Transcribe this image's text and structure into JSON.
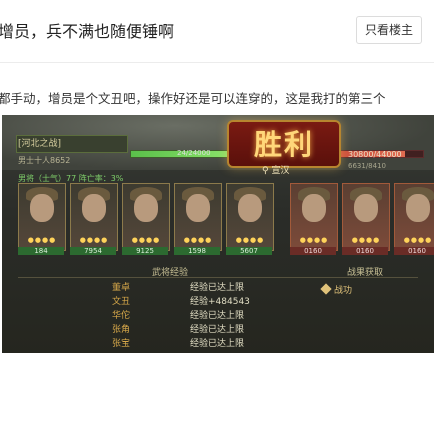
{
  "header": {
    "title": "增员，兵不满也随便锤啊",
    "only_op_label": "只看楼主"
  },
  "post": {
    "text": "都手动，增员是个文丑吧，操作好还是可以连穿的，这是我打的第三个"
  },
  "game": {
    "top_label": "[河北之战]",
    "sub_label": "男士十人8652",
    "army_info": "男将（士气）77  阵亡率：3%",
    "green_value": "24/24000",
    "score": "30800/44000",
    "score_sub": "6631/8410",
    "victory_text": "胜利",
    "location": "宣汉",
    "hp_left": [
      "184",
      "7954",
      "9125",
      "1598",
      "5607"
    ],
    "hp_right": [
      "0160",
      "0160",
      "0160"
    ],
    "section_exp": "武将经验",
    "section_reward": "战果获取",
    "reward_item": "战功",
    "exp_rows": [
      {
        "name": "董卓",
        "status": "经验已达上限"
      },
      {
        "name": "文丑",
        "status": "经验+484543"
      },
      {
        "name": "华佗",
        "status": "经验已达上限"
      },
      {
        "name": "张角",
        "status": "经验已达上限"
      },
      {
        "name": "张宝",
        "status": "经验已达上限"
      }
    ]
  }
}
